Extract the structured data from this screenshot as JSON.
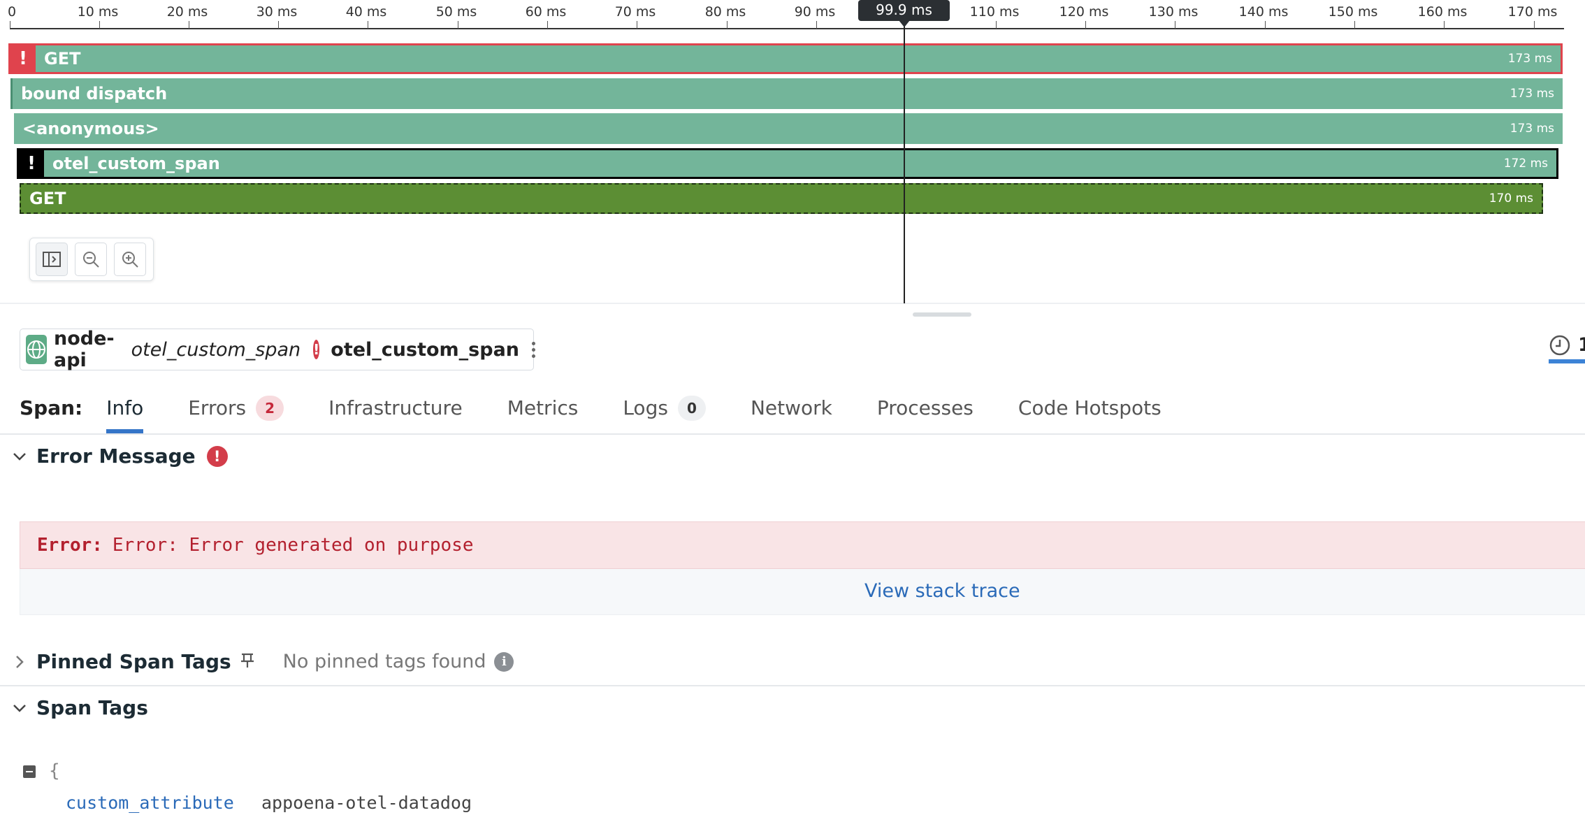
{
  "timeline": {
    "ticks": [
      "0",
      "10 ms",
      "20 ms",
      "30 ms",
      "40 ms",
      "50 ms",
      "60 ms",
      "70 ms",
      "80 ms",
      "90 ms",
      "110 ms",
      "120 ms",
      "130 ms",
      "140 ms",
      "150 ms",
      "160 ms",
      "170 ms"
    ],
    "cursor_label": "99.9 ms",
    "spans": [
      {
        "label": "GET",
        "duration": "173 ms",
        "error": true,
        "error_glyph": "!"
      },
      {
        "label": "bound dispatch",
        "duration": "173 ms"
      },
      {
        "label": "<anonymous>",
        "duration": "173 ms"
      },
      {
        "label": "otel_custom_span",
        "duration": "172 ms",
        "error": true,
        "error_glyph": "!"
      },
      {
        "label": "GET",
        "duration": "170 ms"
      }
    ],
    "colors": {
      "span": "#73b59a",
      "span_child": "#5c8e34",
      "error": "#e0434d"
    }
  },
  "header": {
    "service": "node-api",
    "operation": "otel_custom_span",
    "error_glyph": "!",
    "resource": "otel_custom_span",
    "clock_count": "1"
  },
  "tabs": {
    "prefix": "Span:",
    "items": [
      {
        "label": "Info"
      },
      {
        "label": "Errors",
        "badge": "2"
      },
      {
        "label": "Infrastructure"
      },
      {
        "label": "Metrics"
      },
      {
        "label": "Logs",
        "badge": "0"
      },
      {
        "label": "Network"
      },
      {
        "label": "Processes"
      },
      {
        "label": "Code Hotspots"
      }
    ]
  },
  "error_section": {
    "title": "Error Message",
    "error_glyph": "!",
    "error_type": "Error:",
    "error_message": "Error: Error generated on purpose",
    "stack_link": "View stack trace"
  },
  "pinned_section": {
    "title": "Pinned Span Tags",
    "empty_text": "No pinned tags found",
    "info_glyph": "i"
  },
  "span_tags": {
    "title": "Span Tags",
    "open_brace": "{",
    "key": "custom_attribute",
    "value": "appoena-otel-datadog"
  }
}
